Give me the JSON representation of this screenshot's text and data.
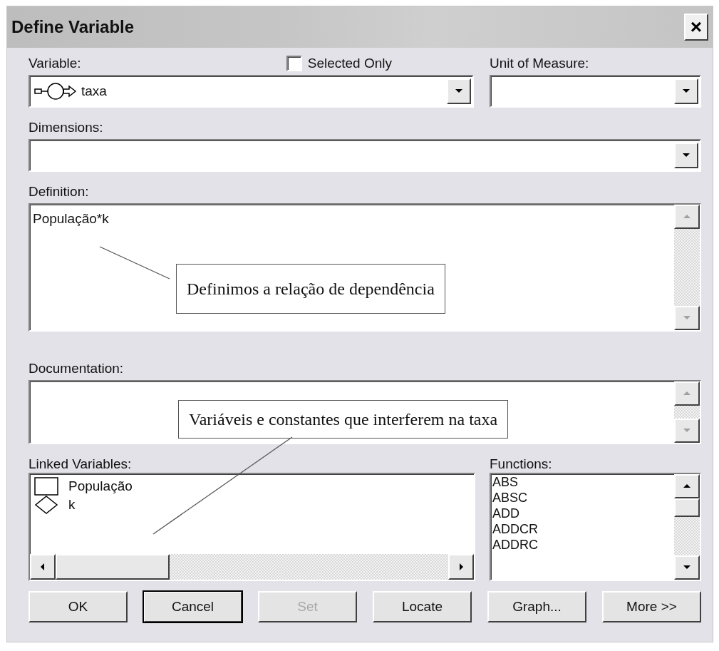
{
  "window": {
    "title": "Define Variable",
    "close": "×"
  },
  "variable": {
    "label": "Variable:",
    "value": "taxa"
  },
  "selected_only": {
    "label": "Selected Only",
    "checked": false
  },
  "unit_of_measure": {
    "label": "Unit of Measure:"
  },
  "dimensions": {
    "label": "Dimensions:"
  },
  "definition": {
    "label": "Definition:",
    "value": "População*k"
  },
  "documentation": {
    "label": "Documentation:"
  },
  "linked_variables": {
    "label": "Linked Variables:",
    "items": [
      {
        "name": "População",
        "kind": "stock"
      },
      {
        "name": "k",
        "kind": "constant"
      }
    ]
  },
  "functions": {
    "label": "Functions:",
    "items": [
      "ABS",
      "ABSC",
      "ADD",
      "ADDCR",
      "ADDRC"
    ]
  },
  "buttons": [
    {
      "label": "OK",
      "disabled": false,
      "focused": false
    },
    {
      "label": "Cancel",
      "disabled": false,
      "focused": true
    },
    {
      "label": "Set",
      "disabled": true,
      "focused": false
    },
    {
      "label": "Locate",
      "disabled": false,
      "focused": false
    },
    {
      "label": "Graph...",
      "disabled": false,
      "focused": false
    },
    {
      "label": "More >>",
      "disabled": false,
      "focused": false
    }
  ],
  "annotations": [
    {
      "text": "Definimos a relação de dependência"
    },
    {
      "text": "Variáveis e constantes que interferem na taxa"
    }
  ]
}
